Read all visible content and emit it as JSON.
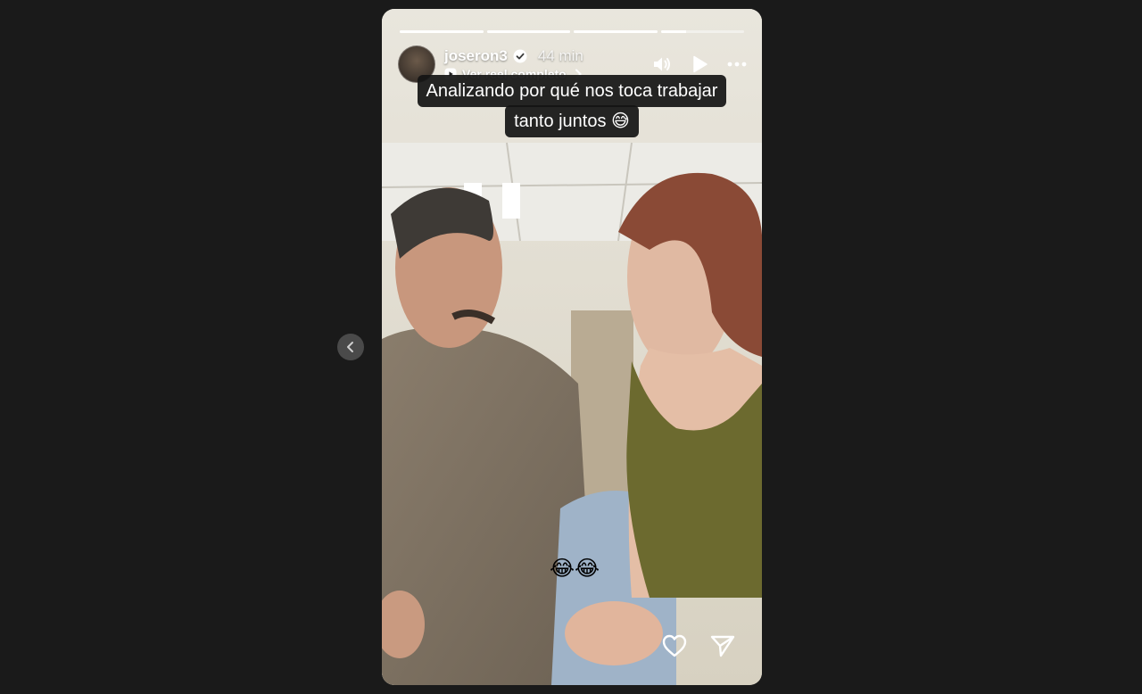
{
  "story": {
    "progress": [
      1,
      1,
      1,
      0.3
    ],
    "user": {
      "username": "joseron3",
      "verified": true,
      "time_ago": "44 min",
      "avatar_icon": "avatar"
    },
    "reel_link_label": "Ver reel completo",
    "caption": {
      "line1": "Analizando por qué nos toca trabajar",
      "line2": "tanto juntos 😅"
    },
    "sticker": "😂😂",
    "icons": {
      "sound": "speaker-icon",
      "play": "play-icon",
      "more": "more-icon",
      "like": "heart-icon",
      "share": "send-icon",
      "prev": "chevron-left-icon"
    }
  },
  "colors": {
    "page_bg": "#1a1a1a",
    "caption_bg": "#141414",
    "text": "#ffffff"
  }
}
